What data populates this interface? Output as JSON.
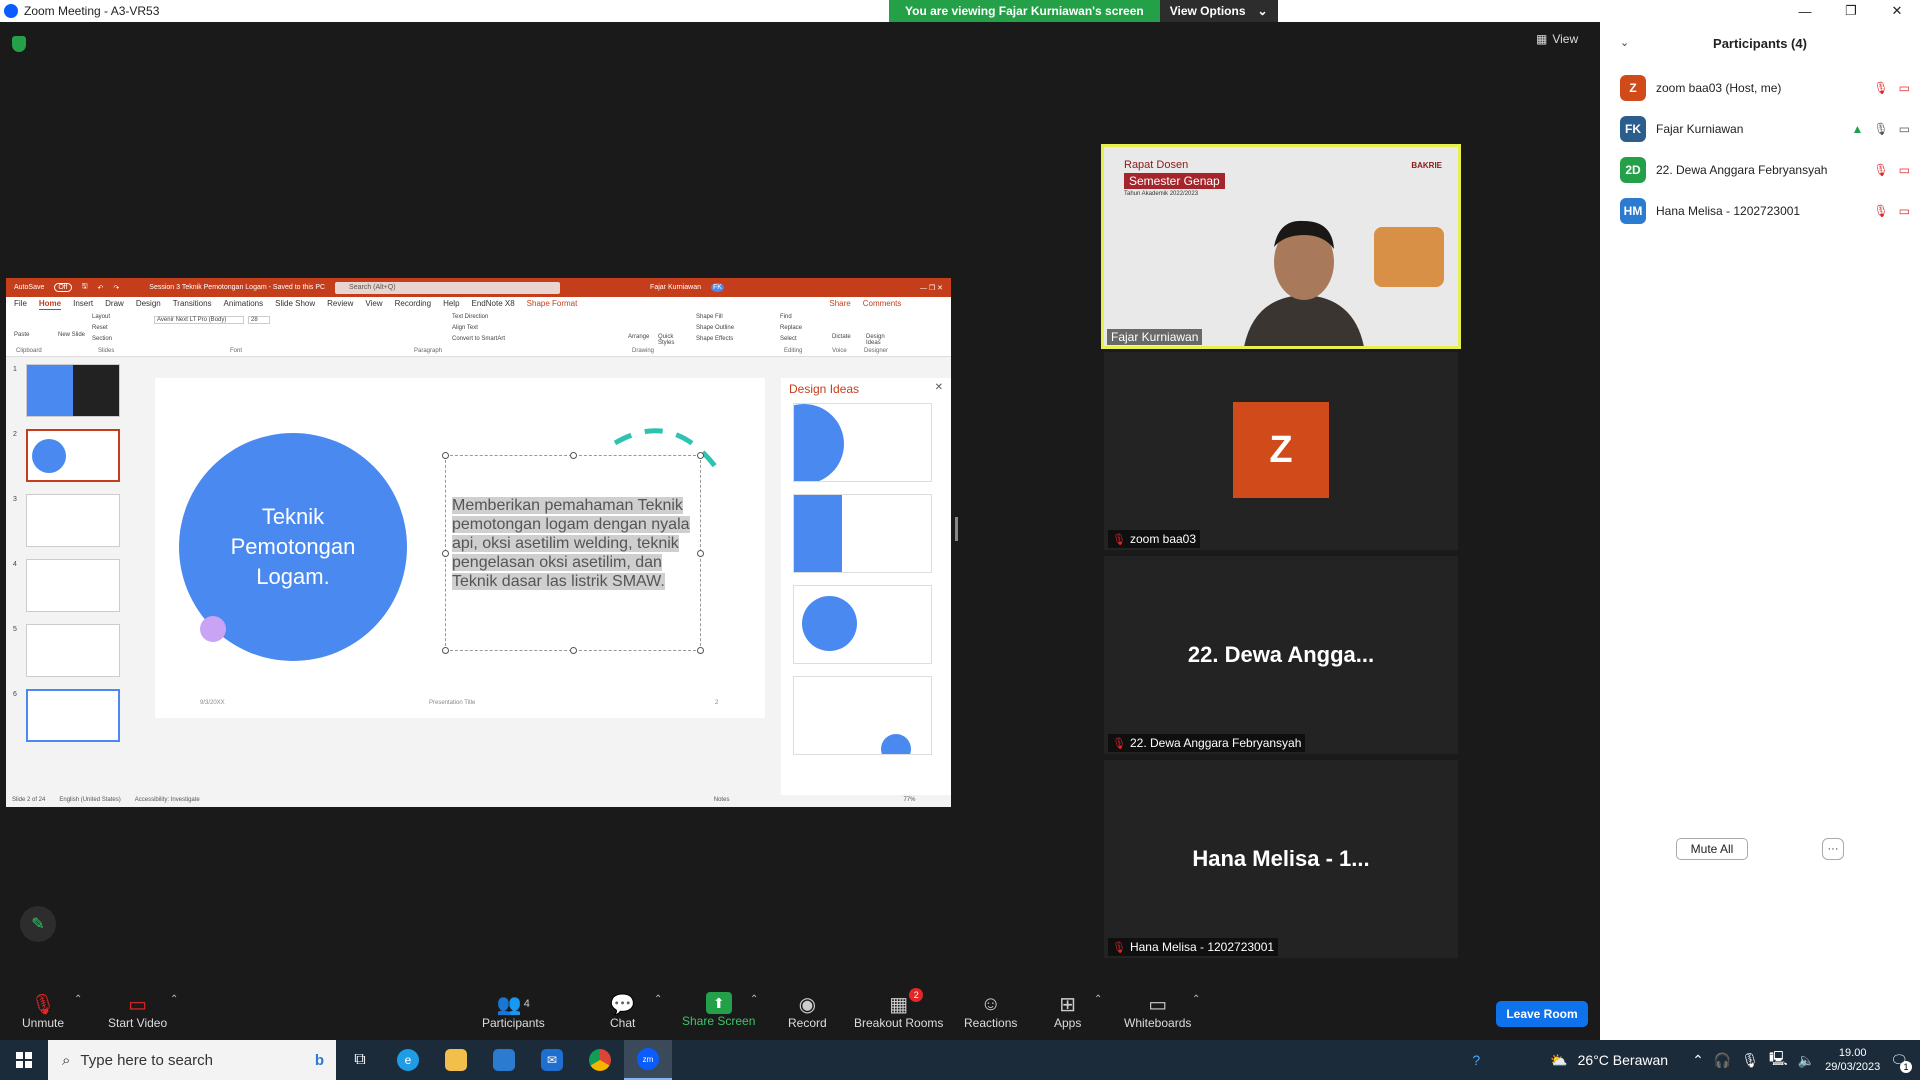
{
  "window": {
    "title": "Zoom Meeting - A3-VR53"
  },
  "banner": {
    "viewing": "You are viewing Fajar Kurniawan's screen",
    "options": "View Options"
  },
  "view_label": "View",
  "ppt": {
    "autosave": "AutoSave",
    "autosave_state": "Off",
    "doc_title": "Session 3 Teknik Pemotongan Logam - Saved to this PC",
    "search": "Search (Alt+Q)",
    "user": "Fajar Kurniawan",
    "user_initials": "FK",
    "tabs": [
      "File",
      "Home",
      "Insert",
      "Draw",
      "Design",
      "Transitions",
      "Animations",
      "Slide Show",
      "Review",
      "View",
      "Recording",
      "Help",
      "EndNote X8",
      "Shape Format"
    ],
    "share": "Share",
    "comments": "Comments",
    "font_name": "Avenir Next LT Pro (Body)",
    "font_size": "28",
    "ribbon_groups": [
      "Clipboard",
      "Slides",
      "Font",
      "Paragraph",
      "Drawing",
      "Editing",
      "Voice",
      "Designer"
    ],
    "ribbon_items": {
      "paste": "Paste",
      "new_slide": "New Slide",
      "layout": "Layout",
      "reset": "Reset",
      "section": "Section",
      "text_direction": "Text Direction",
      "align_text": "Align Text",
      "convert_smartart": "Convert to SmartArt",
      "arrange": "Arrange",
      "quick_styles": "Quick Styles",
      "shape_fill": "Shape Fill",
      "shape_outline": "Shape Outline",
      "shape_effects": "Shape Effects",
      "find": "Find",
      "replace": "Replace",
      "select": "Select",
      "dictate": "Dictate",
      "design_ideas": "Design Ideas"
    },
    "slide_numbers": [
      "1",
      "2",
      "3",
      "4",
      "5",
      "6"
    ],
    "slide": {
      "title": "Teknik Pemotongan Logam.",
      "body": "Memberikan pemahaman Teknik pemotongan logam dengan nyala api, oksi asetilim welding, teknik pengelasan oksi asetilim, dan Teknik dasar las listrik SMAW.",
      "date": "9/3/20XX",
      "footer": "Presentation Title",
      "page": "2"
    },
    "design_ideas_title": "Design Ideas",
    "status": {
      "slide": "Slide 2 of 24",
      "language": "English (United States)",
      "accessibility": "Accessibility: Investigate",
      "notes": "Notes",
      "zoom": "77%"
    }
  },
  "tiles": {
    "speaker": {
      "name": "Fajar Kurniawan",
      "rapat": "Rapat Dosen",
      "semester": "Semester Genap",
      "tahun": "Tahun Akademik 2022/2023",
      "brand": "BAKRIE"
    },
    "zoom_baa03": {
      "initial": "Z",
      "name": "zoom baa03"
    },
    "dewa": {
      "big": "22. Dewa Angga...",
      "name": "22. Dewa Anggara Febryansyah"
    },
    "hana": {
      "big": "Hana Melisa - 1...",
      "name": "Hana Melisa - 1202723001"
    }
  },
  "participants": {
    "title": "Participants (4)",
    "list": [
      {
        "initials": "Z",
        "name": "zoom baa03 (Host, me)",
        "color": "#d04a1a"
      },
      {
        "initials": "FK",
        "name": "Fajar Kurniawan",
        "color": "#2b5e8c"
      },
      {
        "initials": "2D",
        "name": "22. Dewa Anggara Febryansyah",
        "color": "#24a148"
      },
      {
        "initials": "HM",
        "name": "Hana Melisa - 1202723001",
        "color": "#2b7bd0"
      }
    ],
    "mute_all": "Mute All",
    "more": "···"
  },
  "toolbar": {
    "unmute": "Unmute",
    "start_video": "Start Video",
    "participants": "Participants",
    "participants_count": "4",
    "chat": "Chat",
    "share_screen": "Share Screen",
    "record": "Record",
    "breakout": "Breakout Rooms",
    "breakout_badge": "2",
    "reactions": "Reactions",
    "apps": "Apps",
    "whiteboards": "Whiteboards",
    "leave": "Leave Room"
  },
  "taskbar": {
    "search": "Type here to search",
    "weather": "26°C  Berawan",
    "time": "19.00",
    "date": "29/03/2023",
    "notif": "1"
  }
}
